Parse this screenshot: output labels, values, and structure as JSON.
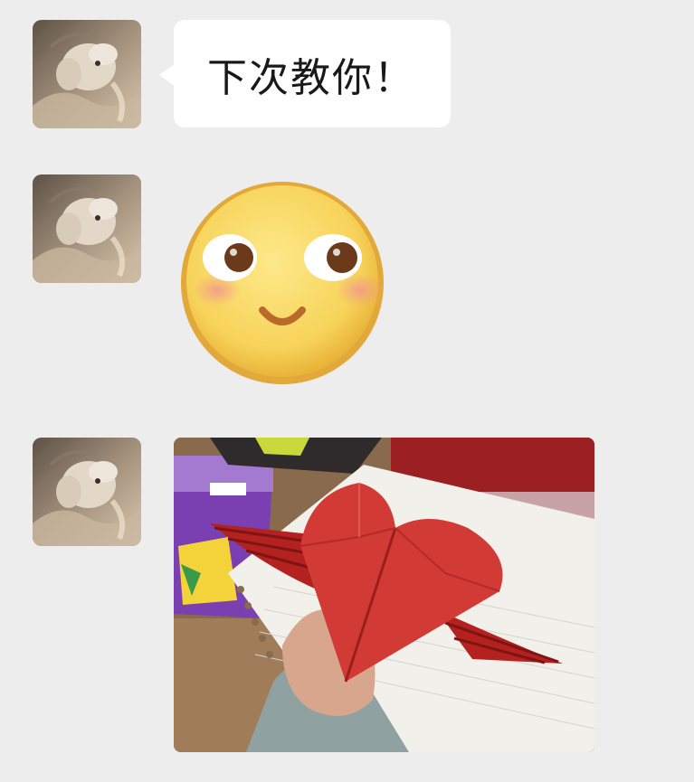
{
  "messages": [
    {
      "type": "text",
      "text": "下次教你！"
    },
    {
      "type": "sticker",
      "icon": "blushing-face-emoji"
    },
    {
      "type": "image",
      "icon": "origami-winged-heart-photo"
    }
  ],
  "colors": {
    "background": "#ededed",
    "bubble": "#ffffff",
    "text": "#191919"
  }
}
